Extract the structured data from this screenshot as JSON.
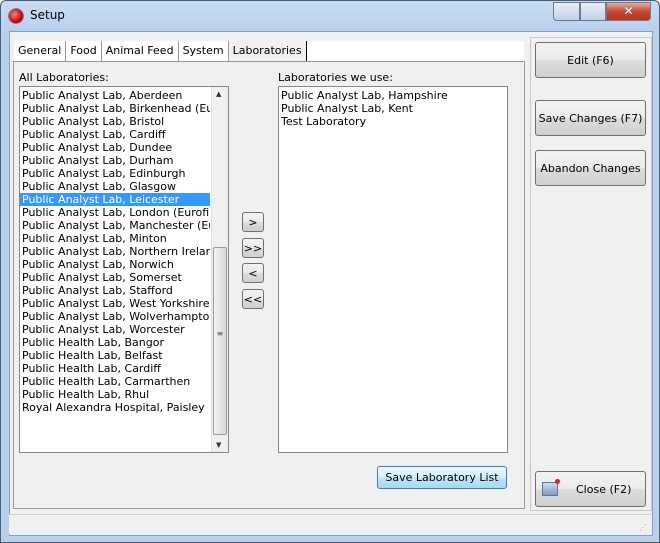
{
  "window": {
    "title": "Setup",
    "min": "▁",
    "max": "□",
    "close": "✕"
  },
  "tabs": [
    "General",
    "Food",
    "Animal Feed",
    "System",
    "Laboratories"
  ],
  "active_tab": "Laboratories",
  "all_labs": {
    "label": "All Laboratories:",
    "selected": "Public Analyst Lab, Leicester",
    "items": [
      "Public Analyst Lab, Aberdeen",
      "Public Analyst Lab, Birkenhead (Eurofins)",
      "Public Analyst Lab, Bristol",
      "Public Analyst Lab, Cardiff",
      "Public Analyst Lab, Dundee",
      "Public Analyst Lab, Durham",
      "Public Analyst Lab, Edinburgh",
      "Public Analyst Lab, Glasgow",
      "Public Analyst Lab, Leicester",
      "Public Analyst Lab, London (Eurofins)",
      "Public Analyst Lab, Manchester (Eurofins)",
      "Public Analyst Lab, Minton",
      "Public Analyst Lab, Northern Ireland (Eurofins)",
      "Public Analyst Lab, Norwich",
      "Public Analyst Lab, Somerset",
      "Public Analyst Lab, Stafford",
      "Public Analyst Lab, West Yorkshire",
      "Public Analyst Lab, Wolverhampton (Eurofins)",
      "Public Analyst Lab, Worcester",
      "Public Health Lab, Bangor",
      "Public Health Lab, Belfast",
      "Public Health Lab, Cardiff",
      "Public Health Lab, Carmarthen",
      "Public Health Lab, Rhul",
      "Royal Alexandra Hospital, Paisley"
    ]
  },
  "used_labs": {
    "label": "Laboratories we use:",
    "items": [
      "Public Analyst Lab, Hampshire",
      "Public Analyst Lab, Kent",
      "Test Laboratory"
    ]
  },
  "move_buttons": {
    "add": ">",
    "add_all": ">>",
    "remove": "<",
    "remove_all": "<<"
  },
  "save_list": "Save Laboratory List",
  "side": {
    "edit": "Edit (F6)",
    "save": "Save Changes (F7)",
    "abandon": "Abandon Changes",
    "close": "Close (F2)"
  }
}
